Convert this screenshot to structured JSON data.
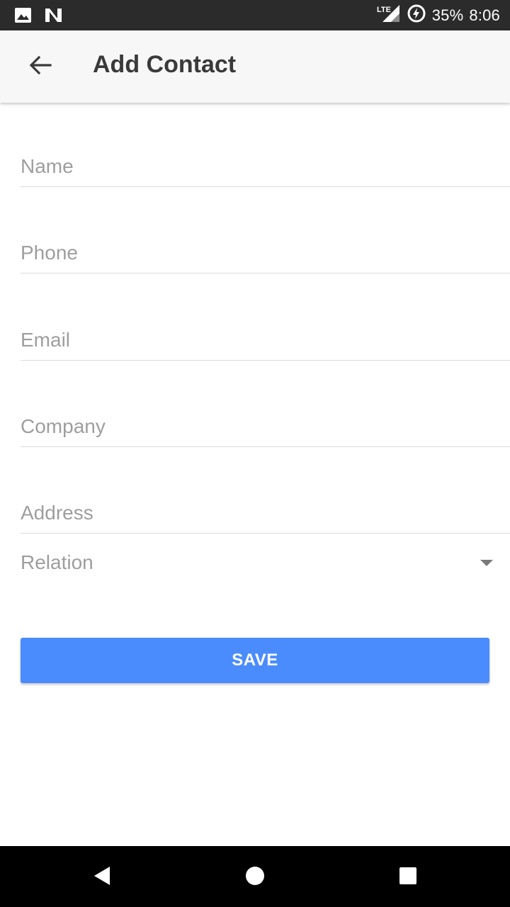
{
  "status_bar": {
    "network": "LTE",
    "battery": "35%",
    "time": "8:06",
    "icons": [
      "image-notification-icon",
      "n-notification-icon",
      "signal-icon",
      "battery-charging-icon"
    ]
  },
  "app_bar": {
    "title": "Add Contact",
    "back_icon": "arrow-back-icon"
  },
  "form": {
    "name": {
      "value": "",
      "placeholder": "Name"
    },
    "phone": {
      "value": "",
      "placeholder": "Phone"
    },
    "email": {
      "value": "",
      "placeholder": "Email"
    },
    "company": {
      "value": "",
      "placeholder": "Company"
    },
    "address": {
      "value": "",
      "placeholder": "Address"
    },
    "relation": {
      "selected": "Relation",
      "icon": "dropdown-arrow-icon"
    }
  },
  "save_button": {
    "label": "SAVE",
    "color": "#4a8cfd"
  },
  "nav_bar": {
    "icons": [
      "back-triangle-icon",
      "home-circle-icon",
      "recents-square-icon"
    ]
  }
}
